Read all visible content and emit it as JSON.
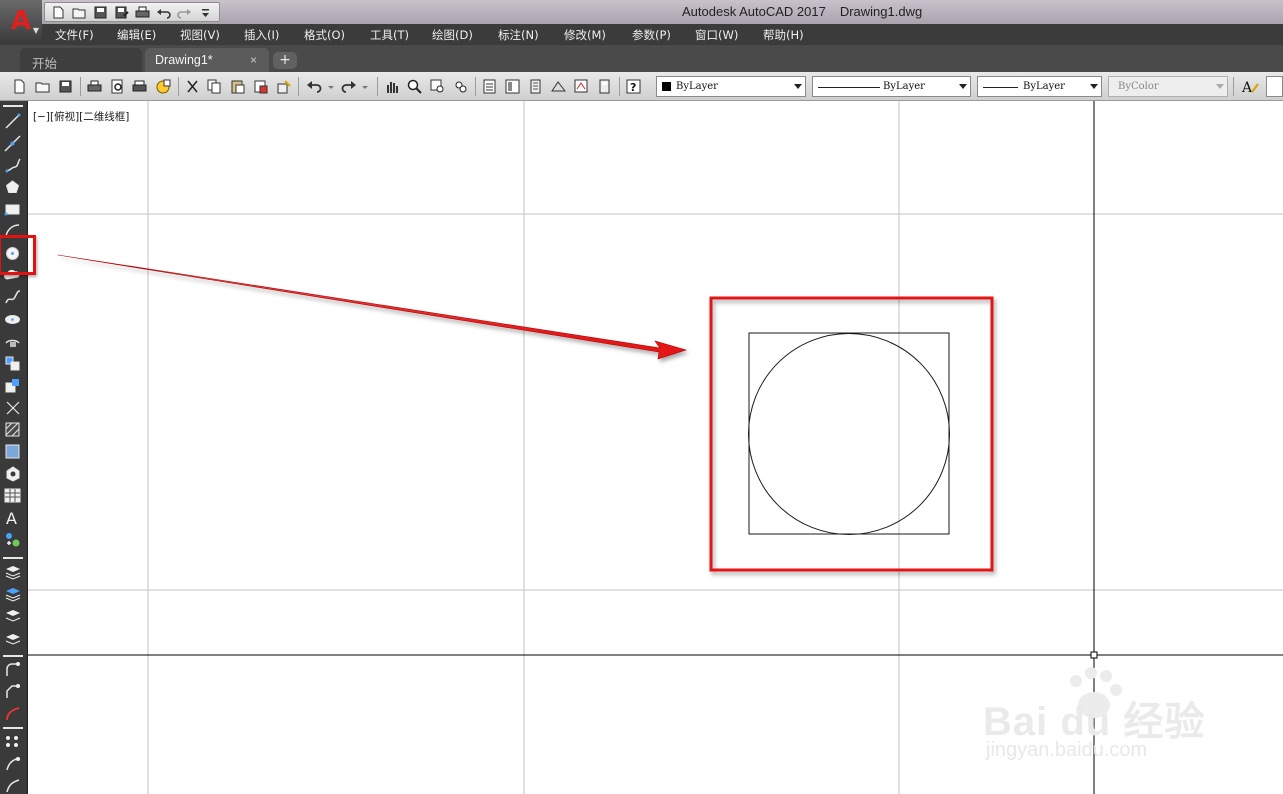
{
  "window": {
    "app_name": "Autodesk AutoCAD 2017",
    "file_name": "Drawing1.dwg",
    "logo_letter": "A"
  },
  "menu": {
    "items": [
      "文件(F)",
      "编辑(E)",
      "视图(V)",
      "插入(I)",
      "格式(O)",
      "工具(T)",
      "绘图(D)",
      "标注(N)",
      "修改(M)",
      "参数(P)",
      "窗口(W)",
      "帮助(H)"
    ]
  },
  "tabs": {
    "start_label": "开始",
    "drawing_label": "Drawing1*",
    "close_glyph": "×",
    "new_glyph": "+"
  },
  "properties": {
    "color": "ByLayer",
    "linetype": "ByLayer",
    "lineweight": "ByLayer",
    "plotstyle": "ByColor"
  },
  "viewport": {
    "label": "[−][俯视][二维线框]"
  },
  "watermark": {
    "brand": "Bai du 经验",
    "url": "jingyan.baidu.com"
  },
  "colors": {
    "annotation_red": "#e31212",
    "title_bar": "#b9b2bd",
    "menu_bar": "#3b3b3b",
    "palette": "#3a3a3a",
    "grid": "#bfbfc6",
    "axis": "#000000"
  },
  "icons": {
    "qat": [
      "new-icon",
      "open-icon",
      "save-icon",
      "save-as-icon",
      "print-icon",
      "undo-icon",
      "redo-icon",
      "customize-icon"
    ],
    "palette": [
      "line-icon",
      "construction-line-icon",
      "polyline-icon",
      "polygon-icon",
      "rectangle-icon",
      "arc-icon",
      "circle-icon",
      "revision-cloud-icon",
      "spline-icon",
      "ellipse-icon",
      "ellipse-arc-icon",
      "insert-block-icon",
      "make-block-icon",
      "point-icon",
      "hatch-icon",
      "gradient-icon",
      "region-icon",
      "table-icon",
      "multiline-text-icon",
      "add-selected-icon"
    ]
  }
}
